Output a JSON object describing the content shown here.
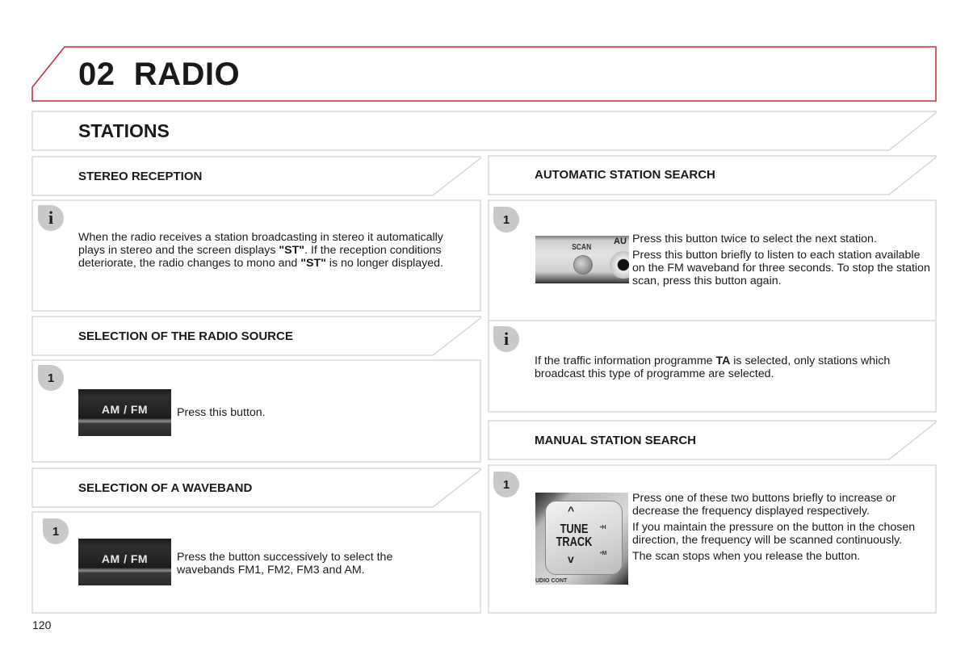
{
  "chapter": {
    "number": "02",
    "title": "RADIO",
    "accent_color": "#c8283c"
  },
  "section": {
    "title": "STATIONS"
  },
  "left_column": {
    "stereo_reception": {
      "title": "STEREO RECEPTION",
      "badge": "info-icon",
      "text_parts": [
        "When the radio receives a station broadcasting in stereo it automatically plays in stereo and the screen displays ",
        "\"ST\"",
        ". If the reception conditions deteriorate, the radio changes to mono and ",
        "\"ST\"",
        " is no longer displayed."
      ]
    },
    "radio_source": {
      "title": "SELECTION OF THE RADIO SOURCE",
      "badge": "1",
      "button_label": "AM / FM",
      "text": "Press this button."
    },
    "waveband": {
      "title": "SELECTION OF A WAVEBAND",
      "badge": "1",
      "button_label": "AM / FM",
      "text": "Press the button successively to select the wavebands FM1, FM2, FM3 and AM."
    }
  },
  "right_column": {
    "automatic_search": {
      "title": "AUTOMATIC STATION SEARCH",
      "badge": "1",
      "image_labels": {
        "scan": "SCAN",
        "aux": "AU"
      },
      "paragraphs": [
        "Press this button twice to select the next station.",
        "Press this button briefly to listen to each station available on the FM waveband for three seconds. To stop the station scan, press this button again."
      ]
    },
    "traffic_info": {
      "badge": "info-icon",
      "text_parts": [
        "If the traffic information programme ",
        "TA",
        " is selected, only stations which broadcast this type of programme are selected."
      ]
    },
    "manual_search": {
      "title": "MANUAL STATION SEARCH",
      "badge": "1",
      "image_labels": {
        "line1": "TUNE",
        "line2": "TRACK",
        "up": "^",
        "down": "v",
        "h": "•H",
        "m": "•M",
        "bottom": "UDIO CONT"
      },
      "paragraphs": [
        "Press one of these two buttons briefly to increase or decrease the frequency displayed respectively.",
        "If you maintain the pressure on the button in the chosen direction, the frequency will be scanned continuously.",
        "The scan stops when you release the button."
      ]
    }
  },
  "footer": {
    "page_number": "120"
  }
}
